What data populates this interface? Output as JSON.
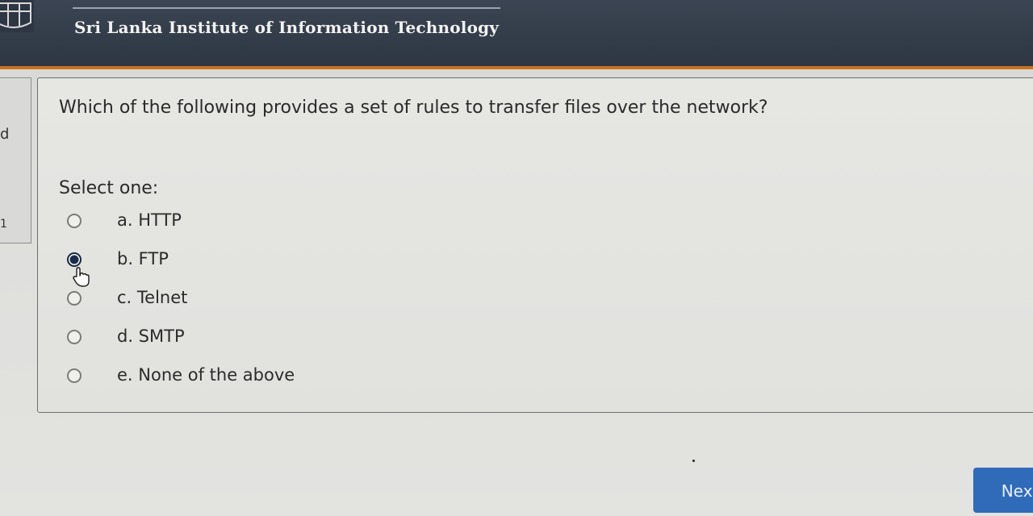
{
  "header": {
    "institute_name": "Sri Lanka Institute of Information Technology"
  },
  "left_panel": {
    "fragment_top": "d",
    "fragment_bottom": "1"
  },
  "question": {
    "text": "Which of the following provides a set of rules to transfer files over the network?",
    "prompt": "Select one:",
    "options": [
      {
        "label": "a. HTTP",
        "selected": false
      },
      {
        "label": "b. FTP",
        "selected": true
      },
      {
        "label": "c. Telnet",
        "selected": false
      },
      {
        "label": "d. SMTP",
        "selected": false
      },
      {
        "label": "e. None of the above",
        "selected": false
      }
    ]
  },
  "navigation": {
    "next_label": "Next"
  },
  "colors": {
    "header_bg": "#333c49",
    "header_accent": "#c9731f",
    "next_button": "#2f6bb9"
  }
}
